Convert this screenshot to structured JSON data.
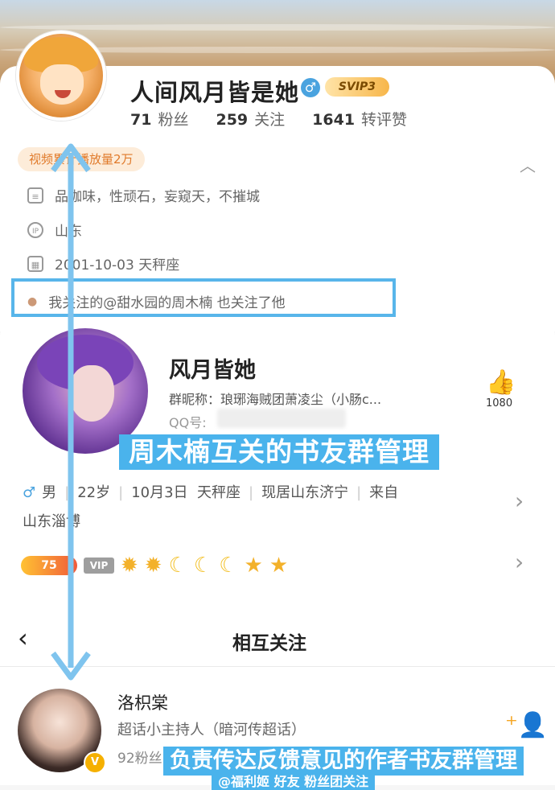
{
  "weibo_profile": {
    "name": "人间风月皆是她",
    "gender_icon": "♂",
    "svip_badge": "SVIP3",
    "stats": [
      {
        "value": "71",
        "label": "粉丝"
      },
      {
        "value": "259",
        "label": "关注"
      },
      {
        "value": "1641",
        "label": "转评赞"
      }
    ],
    "video_tag": "视频累计播放量2万",
    "bio": "品咖味，性顽石，妄窥天，不摧城",
    "ip": "山东",
    "birthday": "2001-10-03 天秤座",
    "mutual_note": "我关注的@甜水园的周木楠 也关注了他"
  },
  "qq_profile": {
    "name": "风月皆她",
    "nickname": "群昵称：琅琊海贼团萧凌尘（小肠c...",
    "qq_label": "QQ号:",
    "like_count": "1080",
    "info_line1": [
      "男",
      "22岁",
      "10月3日",
      "天秤座",
      "现居山东济宁",
      "来自"
    ],
    "info_line2": "山东淄博",
    "level": "75",
    "vip": "VIP"
  },
  "annotation1": "周木楠互关的书友群管理",
  "annotation2": "负责传达反馈意见的作者书友群管理",
  "annotation3": "@福利姬 好友 粉丝团关注",
  "mutual_follow": {
    "title": "相互关注",
    "back_icon": "‹",
    "user": {
      "name": "洛枳棠",
      "desc": "超话小主持人（暗河传超话）",
      "fans": "92粉丝"
    }
  },
  "colors": {
    "annotation_blue": "#4ab3ec",
    "arrow_blue": "#7fc4ee",
    "orange_tag": "#e07a2a"
  }
}
